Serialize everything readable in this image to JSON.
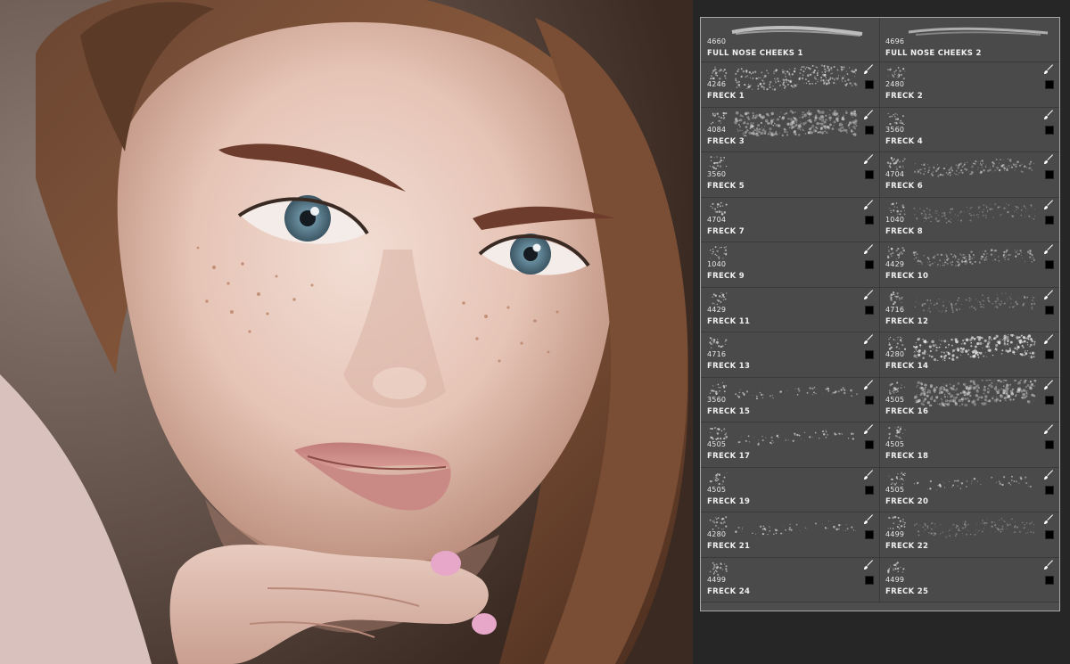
{
  "photo": {
    "name": "freckled-woman-portrait"
  },
  "brush_panel": {
    "accent": "#4a4a4a",
    "header": [
      {
        "size": "4660",
        "label": "FULL NOSE CHEEKS 1"
      },
      {
        "size": "4696",
        "label": "FULL NOSE CHEEKS 2"
      }
    ],
    "rows": [
      [
        {
          "size": "4246",
          "label": "FRECK 1",
          "stroke": "dense"
        },
        {
          "size": "2480",
          "label": "FRECK 2",
          "stroke": "none"
        }
      ],
      [
        {
          "size": "4084",
          "label": "FRECK 3",
          "stroke": "cloud"
        },
        {
          "size": "3560",
          "label": "FRECK 4",
          "stroke": "none"
        }
      ],
      [
        {
          "size": "3560",
          "label": "FRECK 5",
          "stroke": "none"
        },
        {
          "size": "4704",
          "label": "FRECK 6",
          "stroke": "medium"
        }
      ],
      [
        {
          "size": "4704",
          "label": "FRECK 7",
          "stroke": "none"
        },
        {
          "size": "1040",
          "label": "FRECK 8",
          "stroke": "faint"
        }
      ],
      [
        {
          "size": "1040",
          "label": "FRECK 9",
          "stroke": "none"
        },
        {
          "size": "4429",
          "label": "FRECK 10",
          "stroke": "medium"
        }
      ],
      [
        {
          "size": "4429",
          "label": "FRECK 11",
          "stroke": "none"
        },
        {
          "size": "4716",
          "label": "FRECK 12",
          "stroke": "faint"
        }
      ],
      [
        {
          "size": "4716",
          "label": "FRECK 13",
          "stroke": "none"
        },
        {
          "size": "4280",
          "label": "FRECK 14",
          "stroke": "bright"
        }
      ],
      [
        {
          "size": "3560",
          "label": "FRECK 15",
          "stroke": "sparse"
        },
        {
          "size": "4505",
          "label": "FRECK 16",
          "stroke": "cloud"
        }
      ],
      [
        {
          "size": "4505",
          "label": "FRECK 17",
          "stroke": "sparse"
        },
        {
          "size": "4505",
          "label": "FRECK 18",
          "stroke": "none"
        }
      ],
      [
        {
          "size": "4505",
          "label": "FRECK 19",
          "stroke": "none"
        },
        {
          "size": "4505",
          "label": "FRECK 20",
          "stroke": "sparse"
        }
      ],
      [
        {
          "size": "4280",
          "label": "FRECK 21",
          "stroke": "sparse"
        },
        {
          "size": "4499",
          "label": "FRECK 22",
          "stroke": "faint"
        }
      ],
      [
        {
          "size": "4499",
          "label": "FRECK 24",
          "stroke": "none"
        },
        {
          "size": "4499",
          "label": "FRECK 25",
          "stroke": "none"
        }
      ]
    ]
  }
}
